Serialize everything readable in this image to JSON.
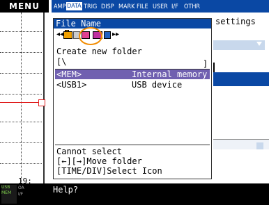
{
  "menu_label": "MENU",
  "tabs": [
    {
      "label": "AMP",
      "active": false
    },
    {
      "label": "DATA",
      "active": true
    },
    {
      "label": "TRIG",
      "active": false
    },
    {
      "label": "DISP",
      "active": false
    },
    {
      "label": "MARK",
      "active": false
    },
    {
      "label": "FILE",
      "active": false
    },
    {
      "label": "USER",
      "active": false
    },
    {
      "label": "I/F",
      "active": false
    },
    {
      "label": "OTHR",
      "active": false
    }
  ],
  "background": {
    "settings_label": "settings"
  },
  "dialog": {
    "title": "File Name",
    "toolbar": {
      "left_arrows": "◂◂",
      "right_arrows": "▸▸",
      "icons": [
        "folder-icon",
        "document-icon",
        "pink-file-icon",
        "magenta-file-icon",
        "blue-file-icon"
      ]
    },
    "mode_text": "Create new folder",
    "path_open": "[\\",
    "path_close": "]",
    "items": [
      {
        "name": "<MEM>",
        "desc": "Internal memory",
        "selected": true
      },
      {
        "name": "<USB1>",
        "desc": "USB device",
        "selected": false
      }
    ],
    "status_lines": [
      "Cannot select",
      "[←][→]Move folder",
      "[TIME/DIV]Select Icon"
    ]
  },
  "waveform": {
    "page_number": "19:"
  },
  "status_bar": {
    "usb_top": "USB",
    "usb_bottom": "MEM",
    "stat_top": "OA",
    "stat_bottom": "I/F",
    "help": "Help?"
  }
}
